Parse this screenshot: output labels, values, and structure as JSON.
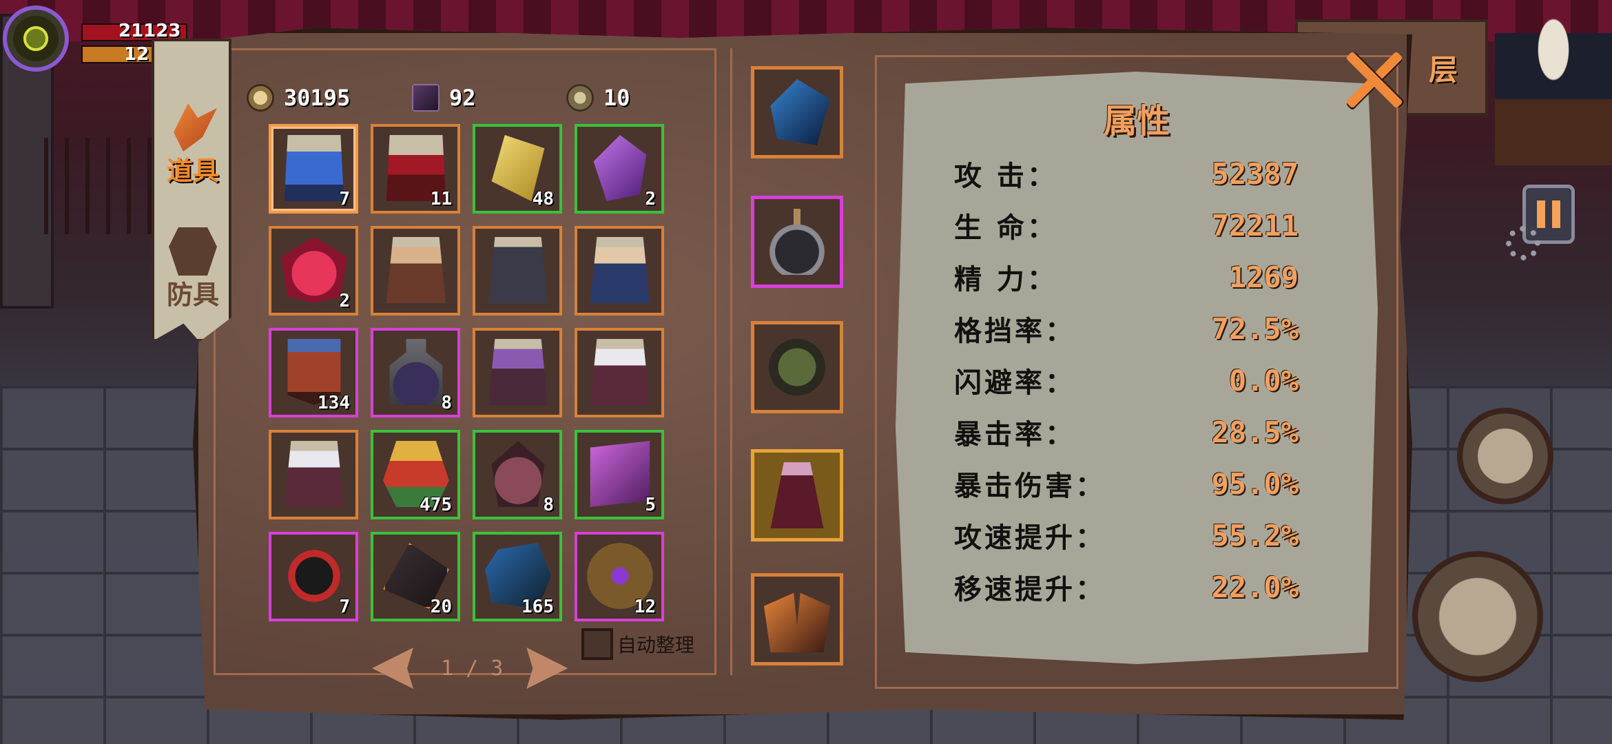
{
  "hud": {
    "hp_value": "21123",
    "mp_value": "12",
    "floor_label": "层"
  },
  "tabs": [
    {
      "label": "道具",
      "icon": "items-icon",
      "active": true
    },
    {
      "label": "防具",
      "icon": "armor-icon",
      "active": false
    }
  ],
  "currencies": [
    {
      "icon": "gold-coin-icon",
      "value": "30195"
    },
    {
      "icon": "spellbook-icon",
      "value": "92"
    },
    {
      "icon": "medal-icon",
      "value": "10"
    }
  ],
  "inventory": [
    {
      "icon": "blue-claw-scroll-icon",
      "qty": "7",
      "rarity": "orange",
      "selected": true
    },
    {
      "icon": "red-blade-scroll-icon",
      "qty": "11",
      "rarity": "orange"
    },
    {
      "icon": "gold-crystal-icon",
      "qty": "48",
      "rarity": "green"
    },
    {
      "icon": "purple-crystal-icon",
      "qty": "2",
      "rarity": "green"
    },
    {
      "icon": "crimson-heart-icon",
      "qty": "2",
      "rarity": "orange"
    },
    {
      "icon": "hero-card-redhair-icon",
      "qty": "",
      "rarity": "orange"
    },
    {
      "icon": "hero-card-hooded-icon",
      "qty": "",
      "rarity": "orange"
    },
    {
      "icon": "hero-card-blonde-icon",
      "qty": "",
      "rarity": "orange"
    },
    {
      "icon": "demon-banner-icon",
      "qty": "134",
      "rarity": "purple"
    },
    {
      "icon": "potion-jar-icon",
      "qty": "8",
      "rarity": "purple"
    },
    {
      "icon": "hero-card-purplehair-icon",
      "qty": "",
      "rarity": "orange"
    },
    {
      "icon": "hero-card-whitehair-icon",
      "qty": "",
      "rarity": "orange"
    },
    {
      "icon": "hero-card-silverhair-icon",
      "qty": "",
      "rarity": "orange"
    },
    {
      "icon": "gift-bell-icon",
      "qty": "475",
      "rarity": "green"
    },
    {
      "icon": "dark-fruit-icon",
      "qty": "8",
      "rarity": "green"
    },
    {
      "icon": "purple-card-icon",
      "qty": "5",
      "rarity": "green"
    },
    {
      "icon": "dark-ring-icon",
      "qty": "7",
      "rarity": "purple"
    },
    {
      "icon": "obsidian-shard-icon",
      "qty": "20",
      "rarity": "green"
    },
    {
      "icon": "blue-ore-icon",
      "qty": "165",
      "rarity": "green"
    },
    {
      "icon": "bronze-amulet-icon",
      "qty": "12",
      "rarity": "purple"
    }
  ],
  "auto_sort_label": "自动整理",
  "pager": {
    "text": "1 / 3"
  },
  "equipment": [
    {
      "icon": "blue-claw-weapon-icon",
      "rarity": "orange"
    },
    {
      "icon": "dark-flask-icon",
      "rarity": "purple"
    },
    {
      "icon": "beetle-armor-icon",
      "rarity": "orange"
    },
    {
      "icon": "crimson-knight-icon",
      "rarity": "gold"
    },
    {
      "icon": "flame-gauntlet-icon",
      "rarity": "orange"
    }
  ],
  "attributes": {
    "title": "属性",
    "rows": [
      {
        "label": "攻 击：",
        "value": "52387"
      },
      {
        "label": "生 命：",
        "value": "72211"
      },
      {
        "label": "精 力：",
        "value": "1269"
      },
      {
        "label": "格挡率：",
        "value": "72.5%"
      },
      {
        "label": "闪避率：",
        "value": "0.0%"
      },
      {
        "label": "暴击率：",
        "value": "28.5%"
      },
      {
        "label": "暴击伤害：",
        "value": "95.0%"
      },
      {
        "label": "攻速提升：",
        "value": "55.2%"
      },
      {
        "label": "移速提升：",
        "value": "22.0%"
      }
    ]
  },
  "colors": {
    "accent_orange": "#f0a060",
    "rarity_orange": "#d8813a",
    "rarity_green": "#39c23a",
    "rarity_purple": "#d640d8",
    "panel_brown": "#6e5246",
    "parchment": "#a8a698"
  }
}
